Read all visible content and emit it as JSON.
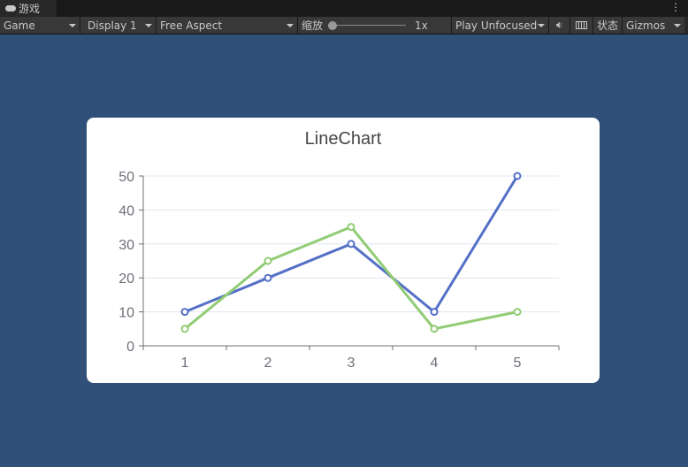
{
  "tab": {
    "label": "游戏",
    "icon": "gamepad-icon"
  },
  "toolbar": {
    "view": "Game",
    "display": "Display 1",
    "aspect": "Free Aspect",
    "scale_label": "缩放",
    "scale_value": "1x",
    "scale_level": 0,
    "play_mode": "Play Unfocused",
    "audio_icon": "speaker-icon",
    "stats": "状态",
    "gizmos": "Gizmos",
    "keyboard_icon": "keyboard-icon"
  },
  "chart_data": {
    "type": "line",
    "title": "LineChart",
    "categories": [
      "1",
      "2",
      "3",
      "4",
      "5"
    ],
    "ylim": [
      0,
      50
    ],
    "yticks": [
      0,
      10,
      20,
      30,
      40,
      50
    ],
    "grid": true,
    "series": [
      {
        "values": [
          10,
          20,
          30,
          10,
          50
        ],
        "color": "#5470c6"
      },
      {
        "values": [
          5,
          25,
          35,
          5,
          10
        ],
        "color": "#91cc75"
      }
    ]
  }
}
